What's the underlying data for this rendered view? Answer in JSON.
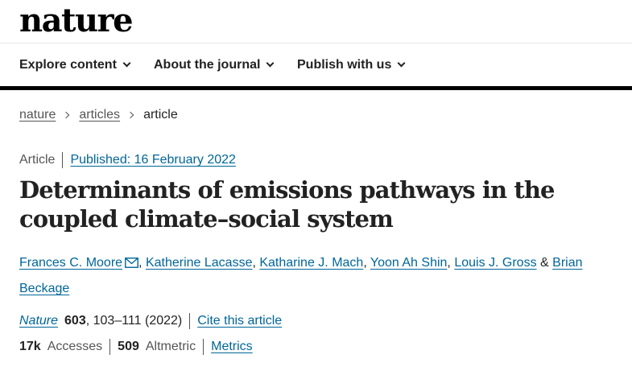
{
  "brand": {
    "logo": "nature"
  },
  "nav": {
    "items": [
      {
        "label": "Explore content"
      },
      {
        "label": "About the journal"
      },
      {
        "label": "Publish with us"
      }
    ]
  },
  "breadcrumb": [
    "nature",
    "articles",
    "article"
  ],
  "article": {
    "type": "Article",
    "published": "Published: 16 February 2022",
    "title": "Determinants of emissions pathways in the coupled climate–social system",
    "authors": [
      "Frances C. Moore",
      "Katherine Lacasse",
      "Katharine J. Mach",
      "Yoon Ah Shin",
      "Louis J. Gross",
      "Brian Beckage"
    ],
    "author_separator": ", ",
    "author_last_separator": " & ",
    "journal": "Nature",
    "volume": "603",
    "pages_year": ", 103–111 (2022)",
    "cite_label": "Cite this article"
  },
  "metrics": {
    "accesses_value": "17k",
    "accesses_label": "Accesses",
    "altmetric_value": "509",
    "altmetric_label": "Altmetric",
    "metrics_link": "Metrics"
  },
  "colors": {
    "link": "#006699",
    "text": "#222222",
    "muted": "#555555"
  },
  "icons": {
    "corresponding_author": "mail-icon",
    "nav_dropdown": "chevron-down-icon",
    "breadcrumb_separator": "chevron-right-icon"
  }
}
